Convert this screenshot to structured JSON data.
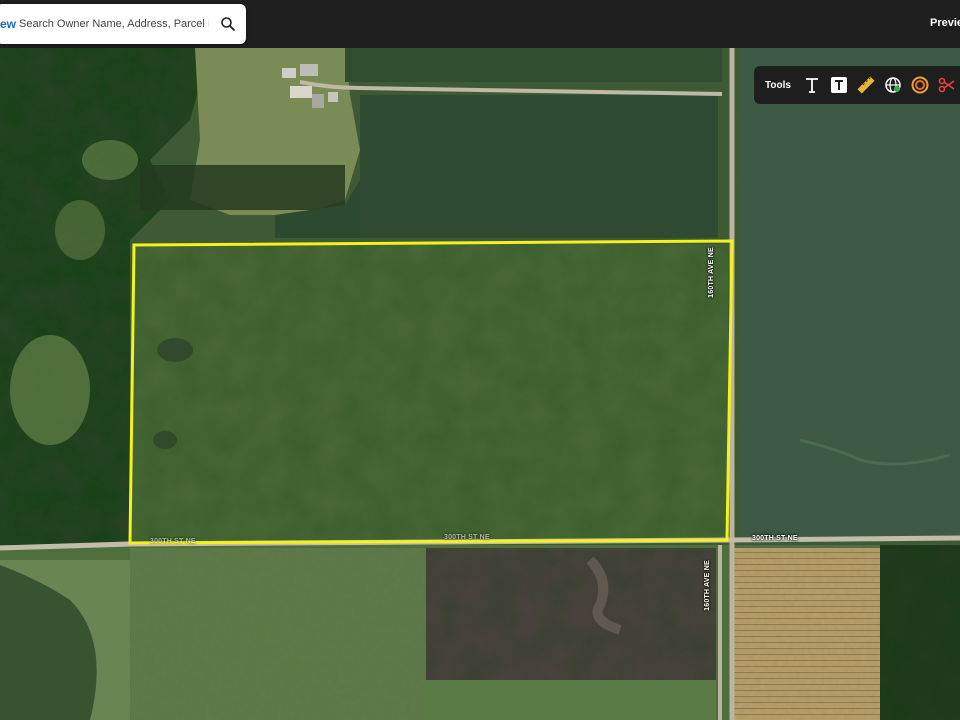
{
  "search": {
    "prefix": "ew",
    "placeholder": "Search Owner Name, Address, Parcel Id"
  },
  "header": {
    "preview_label": "Previe"
  },
  "toolbar": {
    "label": "Tools",
    "tools": [
      {
        "icon": "text-icon"
      },
      {
        "icon": "text-box-icon"
      },
      {
        "icon": "ruler-icon"
      },
      {
        "icon": "globe-icon"
      },
      {
        "icon": "buffer-ring-icon"
      },
      {
        "icon": "scissors-icon"
      }
    ]
  },
  "roads": {
    "road_east_upper": "160TH AVE NE",
    "road_east_lower": "160TH AVE NE",
    "road_south_right": "300TH ST NE",
    "road_south_left": "300TH ST NE",
    "road_south_mid": "300TH ST NE"
  },
  "colors": {
    "parcel_outline": "#f5f01e",
    "topbar": "#1f1f1f",
    "search_prefix": "#1e6ab8"
  }
}
